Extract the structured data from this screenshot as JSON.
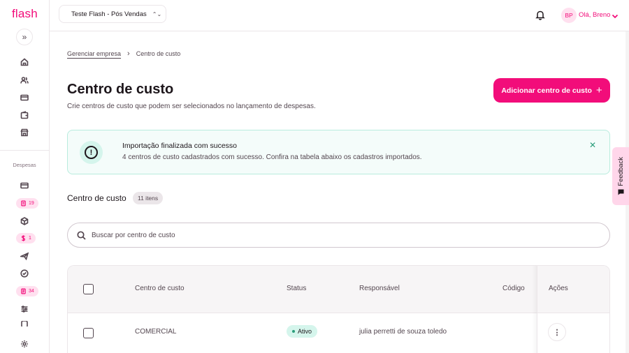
{
  "app": {
    "logo": "flash"
  },
  "sidebar": {
    "expand_glyph": "»",
    "section_label": "Despesas",
    "badges": {
      "expenses": "19",
      "advances": "1",
      "reports": "34"
    }
  },
  "topbar": {
    "company": "Teste Flash - Pós Vendas",
    "avatar_initials": "BP",
    "greeting": "Olá, Breno"
  },
  "breadcrumb": {
    "parent": "Gerenciar empresa",
    "current": "Centro de custo"
  },
  "page": {
    "title": "Centro de custo",
    "subtitle": "Crie centros de custo que podem ser selecionados no lançamento de despesas.",
    "add_button": "Adicionar centro de custo"
  },
  "alert": {
    "title": "Importação finalizada com sucesso",
    "text": "4 centros de custo cadastrados com sucesso. Confira na tabela abaixo os cadastros importados."
  },
  "list": {
    "title": "Centro de custo",
    "count": "11 itens",
    "search_placeholder": "Buscar por centro de custo"
  },
  "table": {
    "columns": {
      "name": "Centro de custo",
      "status": "Status",
      "owner": "Responsável",
      "code": "Código",
      "actions": "Ações"
    },
    "rows": [
      {
        "name": "COMERCIAL",
        "status": "Ativo",
        "owner": "julia perretti de souza toledo",
        "code": ""
      }
    ]
  },
  "feedback": {
    "label": "Feedback"
  },
  "colors": {
    "brand": "#f20d7a",
    "success": "#2a9d7a",
    "success_bg": "#d5f5ec"
  }
}
